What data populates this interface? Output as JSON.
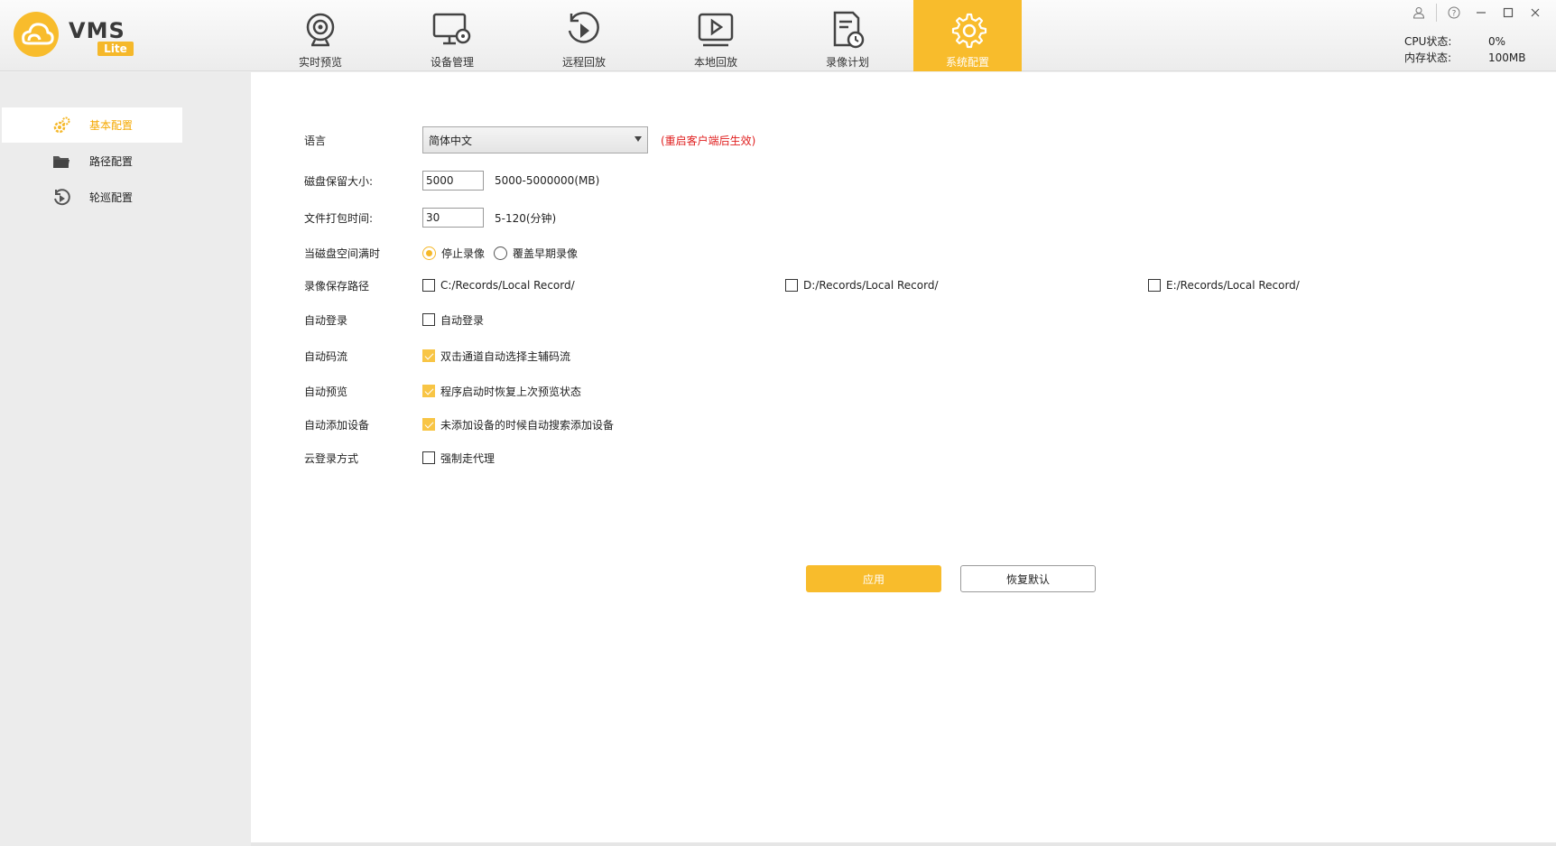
{
  "app": {
    "logo_text": "VMS",
    "logo_badge": "Lite",
    "brand_color": "#f8bc2c"
  },
  "nav": {
    "tabs": [
      {
        "label": "实时预览",
        "icon": "webcam-icon"
      },
      {
        "label": "设备管理",
        "icon": "monitor-settings-icon"
      },
      {
        "label": "远程回放",
        "icon": "replay-icon"
      },
      {
        "label": "本地回放",
        "icon": "play-screen-icon"
      },
      {
        "label": "录像计划",
        "icon": "schedule-doc-icon"
      },
      {
        "label": "系统配置",
        "icon": "gear-icon",
        "active": true
      }
    ]
  },
  "status": {
    "cpu_label": "CPU状态:",
    "cpu_value": "0%",
    "mem_label": "内存状态:",
    "mem_value": "100MB"
  },
  "sidebar": {
    "items": [
      {
        "label": "基本配置",
        "icon": "gears-icon",
        "active": true
      },
      {
        "label": "路径配置",
        "icon": "folder-icon"
      },
      {
        "label": "轮巡配置",
        "icon": "cycle-play-icon"
      }
    ]
  },
  "form": {
    "language": {
      "label": "语言",
      "value": "简体中文",
      "note": "(重启客户端后生效)"
    },
    "disk_reserve": {
      "label": "磁盘保留大小:",
      "value": "5000",
      "hint": "5000-5000000(MB)"
    },
    "pack_time": {
      "label": "文件打包时间:",
      "value": "30",
      "hint": "5-120(分钟)"
    },
    "disk_full": {
      "label": "当磁盘空间满时",
      "options": [
        "停止录像",
        "覆盖早期录像"
      ],
      "selected": "停止录像"
    },
    "save_path": {
      "label": "录像保存路径",
      "options": [
        {
          "label": "C:/Records/Local Record/",
          "checked": false
        },
        {
          "label": "D:/Records/Local Record/",
          "checked": false
        },
        {
          "label": "E:/Records/Local Record/",
          "checked": false
        }
      ]
    },
    "auto_login": {
      "label": "自动登录",
      "option": "自动登录",
      "checked": false
    },
    "auto_stream": {
      "label": "自动码流",
      "option": "双击通道自动选择主辅码流",
      "checked": true
    },
    "auto_preview": {
      "label": "自动预览",
      "option": "程序启动时恢复上次预览状态",
      "checked": true
    },
    "auto_add": {
      "label": "自动添加设备",
      "option": "未添加设备的时候自动搜索添加设备",
      "checked": true
    },
    "cloud_login": {
      "label": "云登录方式",
      "option": "强制走代理",
      "checked": false
    }
  },
  "buttons": {
    "apply": "应用",
    "reset": "恢复默认"
  }
}
